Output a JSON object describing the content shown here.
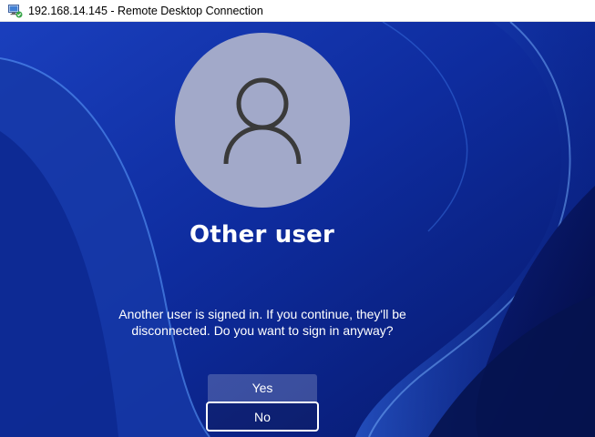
{
  "window": {
    "title": "192.168.14.145 - Remote Desktop Connection",
    "icon": "remote-desktop-icon"
  },
  "lock_screen": {
    "avatar_icon": "user-icon",
    "user_name": "Other user",
    "message": "Another user is signed in. If you continue, they'll be disconnected. Do you want to sign in anyway?",
    "yes_label": "Yes",
    "no_label": "No"
  },
  "colors": {
    "wallpaper_base": "#0c2a9a",
    "avatar_background": "#a2a9c9",
    "avatar_glyph": "#3a3a3a",
    "text": "#ffffff"
  }
}
